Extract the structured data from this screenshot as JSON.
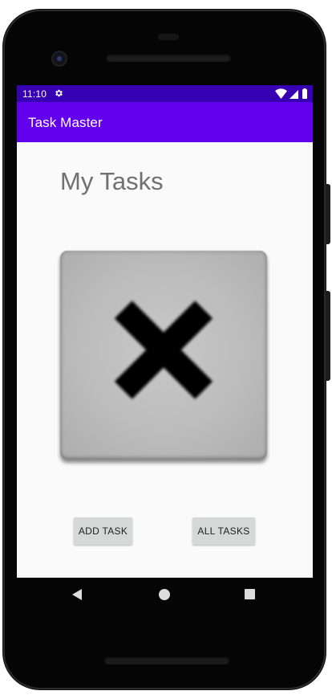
{
  "status_bar": {
    "time": "11:10",
    "settings_icon": "gear-icon",
    "wifi_icon": "wifi-icon",
    "signal_icon": "cellular-signal-icon",
    "battery_icon": "battery-icon"
  },
  "app_bar": {
    "title": "Task Master"
  },
  "main": {
    "title": "My Tasks",
    "image_icon": "close-x-icon"
  },
  "buttons": {
    "add_task": "ADD TASK",
    "all_tasks": "ALL TASKS"
  },
  "navigation": {
    "back_icon": "back-triangle-icon",
    "home_icon": "home-circle-icon",
    "recents_icon": "recents-square-icon"
  },
  "colors": {
    "status_bar": "#3700b3",
    "app_bar": "#6200ee",
    "screen_background": "#fafafa",
    "button_background": "#d6d7d7",
    "title_text": "#707070"
  }
}
